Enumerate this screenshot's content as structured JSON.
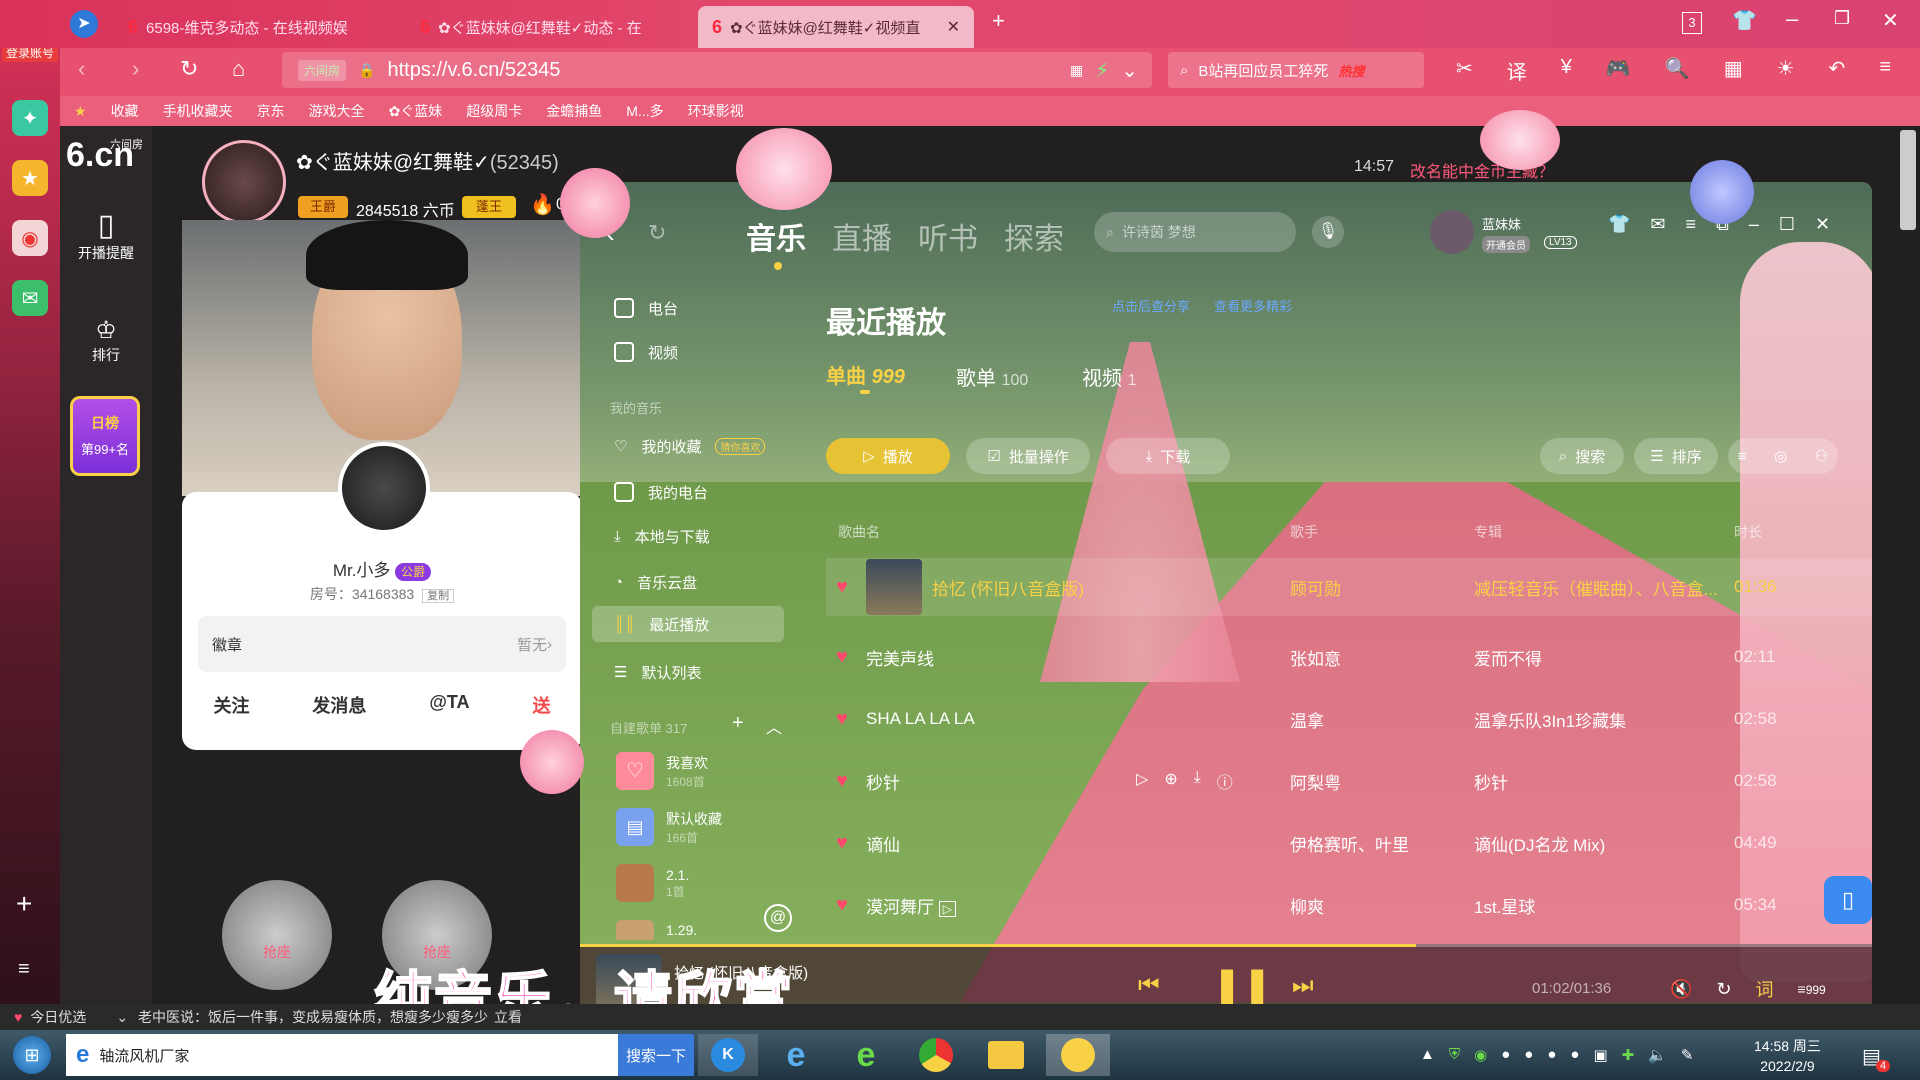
{
  "browser": {
    "tabs": [
      {
        "label": "6598-维克多动态 - 在线视频娱"
      },
      {
        "label": "✿ぐ蓝妹妹@红舞鞋✓动态 - 在"
      },
      {
        "label": "✿ぐ蓝妹妹@红舞鞋✓视频直"
      }
    ],
    "tab_count": "3",
    "login_label": "登录账号",
    "url_prefix": "六间房",
    "url": "https://v.6.cn/52345",
    "search_text": "B站再回应员工猝死",
    "search_badge": "热搜",
    "bookmarks": [
      "收藏",
      "手机收藏夹",
      "京东",
      "游戏大全",
      "✿ぐ蓝妹",
      "超级周卡",
      "金蟾捕鱼",
      "M...多",
      "环球影视"
    ]
  },
  "site": {
    "logo": "6.cn",
    "logo_sub": "六间房",
    "nav": [
      {
        "label": "开播提醒"
      },
      {
        "label": "排行"
      }
    ],
    "rank_badge": {
      "title": "日榜",
      "value": "第99+名"
    },
    "anchor": {
      "name": "✿ぐ蓝妹妹@红舞鞋✓",
      "room_num": "(52345)",
      "title_badge": "王爵",
      "coins": "2845518 六币",
      "rank_badge": "蓬王",
      "fire_count": "0"
    },
    "profile": {
      "name": "Mr.小多",
      "badge": "公爵",
      "room_label": "房号：34168383",
      "copy_label": "复制",
      "medal_label": "徽章",
      "medal_value": "暂无",
      "actions": [
        "关注",
        "发消息",
        "@TA",
        "送"
      ]
    },
    "seats": [
      "抢座",
      "抢座"
    ],
    "bg_time": "14:57",
    "bg_marquee": "改名能中金币主藏？"
  },
  "music": {
    "top_tabs": [
      "音乐",
      "直播",
      "听书",
      "探索"
    ],
    "search_placeholder": "许诗茵 梦想",
    "user": {
      "name": "蓝妹妹",
      "vip": "开通会员",
      "level": "LV13"
    },
    "sidebar": {
      "items": [
        {
          "label": "电台"
        },
        {
          "label": "视频"
        }
      ],
      "section_mine": "我的音乐",
      "mine_items": [
        {
          "label": "我的收藏"
        },
        {
          "label": "我的电台"
        },
        {
          "label": "本地与下载"
        },
        {
          "label": "音乐云盘"
        },
        {
          "label": "最近播放"
        },
        {
          "label": "默认列表"
        }
      ],
      "fav_tag": "猜你喜欢",
      "custom_header": "自建歌单 317",
      "playlists": [
        {
          "name": "我喜欢",
          "count": "1608首"
        },
        {
          "name": "默认收藏",
          "count": "166首"
        },
        {
          "name": "2.1.",
          "count": "1首"
        },
        {
          "name": "1.29.",
          "count": ""
        }
      ]
    },
    "page_title": "最近播放",
    "page_links": [
      "点击后查分享",
      "查看更多精彩"
    ],
    "sub_tabs": [
      {
        "label": "单曲",
        "count": "999"
      },
      {
        "label": "歌单",
        "count": "100"
      },
      {
        "label": "视频",
        "count": "1"
      }
    ],
    "actions": {
      "play": "播放",
      "batch": "批量操作",
      "download": "下载",
      "search": "搜索",
      "sort": "排序"
    },
    "columns": {
      "name": "歌曲名",
      "artist": "歌手",
      "album": "专辑",
      "duration": "时长"
    },
    "songs": [
      {
        "name": "拾忆 (怀旧八音盒版)",
        "artist": "顾可勋",
        "album": "减压轻音乐（催眠曲）、八音盒...",
        "duration": "01:36",
        "current": true
      },
      {
        "name": "完美声线",
        "artist": "张如意",
        "album": "爱而不得",
        "duration": "02:11"
      },
      {
        "name": "SHA LA LA LA",
        "artist": "温拿",
        "album": "温拿乐队3In1珍藏集",
        "duration": "02:58"
      },
      {
        "name": "秒针",
        "artist": "阿梨粤",
        "album": "秒针",
        "duration": "02:58"
      },
      {
        "name": "谪仙",
        "artist": "伊格赛听、叶里",
        "album": "谪仙(DJ名龙 Mix)",
        "duration": "04:49"
      },
      {
        "name": "漠河舞厅",
        "artist": "柳爽",
        "album": "1st.星球",
        "duration": "05:34"
      }
    ],
    "player": {
      "title": "拾忆 (怀旧八音盒版)",
      "time": "01:02/01:36",
      "progress": 0.646,
      "lyric_btn": "词",
      "list_count": "999"
    },
    "overlay_caption": "纯音乐，请欣赏"
  },
  "bottom": {
    "today": "今日优选",
    "news": "老中医说：饭后一件事，变成易瘦体质，想瘦多少瘦多少",
    "news_action": "立看"
  },
  "taskbar": {
    "search_app": "轴流风机厂家",
    "search_btn": "搜索一下",
    "clock_time": "14:58 周三",
    "clock_date": "2022/2/9",
    "notif_count": "4"
  },
  "colors": {
    "accent": "#f9d146",
    "heart": "#ff4a6d",
    "brand": "#e3486c"
  }
}
